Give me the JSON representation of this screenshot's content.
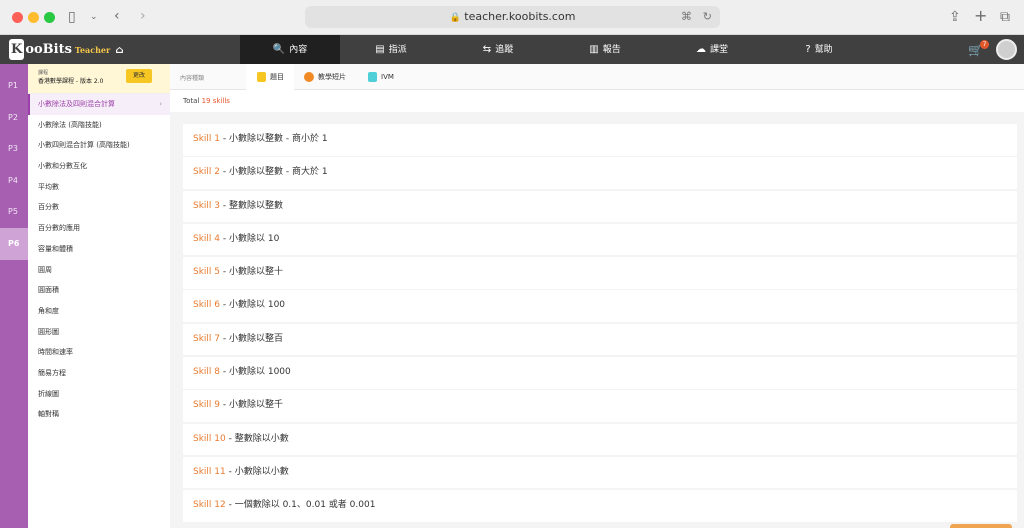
{
  "browser": {
    "url": "teacher.koobits.com"
  },
  "brand": {
    "logo_k": "K",
    "logo_rest": "ooBits",
    "logo_sub": "Teacher"
  },
  "nav": [
    {
      "icon": "search-icon",
      "glyph": "🔍",
      "label": "內容"
    },
    {
      "icon": "assign-icon",
      "glyph": "▤",
      "label": "指派"
    },
    {
      "icon": "track-icon",
      "glyph": "⇆",
      "label": "追蹤"
    },
    {
      "icon": "report-icon",
      "glyph": "▥",
      "label": "報告"
    },
    {
      "icon": "classroom-icon",
      "glyph": "☁",
      "label": "課堂"
    },
    {
      "icon": "help-icon",
      "glyph": "?",
      "label": "幫助"
    }
  ],
  "cart": {
    "count": "7"
  },
  "levels": [
    "P1",
    "P2",
    "P3",
    "P4",
    "P5",
    "P6"
  ],
  "course": {
    "label": "課程",
    "name": "香港數學課程 - 版本 2.0",
    "change": "更改"
  },
  "topics": [
    "小數除法及四則混合計算",
    "小數除法 (高階技能)",
    "小數四則混合計算 (高階技能)",
    "小數和分數互化",
    "平均數",
    "百分數",
    "百分數的應用",
    "容量和體積",
    "圓周",
    "圓面積",
    "角和度",
    "圓形圖",
    "時間和速率",
    "簡易方程",
    "折線圖",
    "軸對稱"
  ],
  "tabs": {
    "label": "內容種類",
    "items": [
      "題目",
      "教學短片",
      "IVM"
    ]
  },
  "total": {
    "prefix": "Total",
    "count": "19 skills"
  },
  "skills": [
    {
      "tag": "Skill 1",
      "name": " - 小數除以整數 - 商小於 1"
    },
    {
      "tag": "Skill 2",
      "name": " - 小數除以整數 - 商大於 1"
    },
    {
      "tag": "Skill 3",
      "name": " - 整數除以整數"
    },
    {
      "tag": "Skill 4",
      "name": " - 小數除以 10"
    },
    {
      "tag": "Skill 5",
      "name": " - 小數除以整十"
    },
    {
      "tag": "Skill 6",
      "name": " - 小數除以 100"
    },
    {
      "tag": "Skill 7",
      "name": " - 小數除以整百"
    },
    {
      "tag": "Skill 8",
      "name": " - 小數除以 1000"
    },
    {
      "tag": "Skill 9",
      "name": " - 小數除以整千"
    },
    {
      "tag": "Skill 10",
      "name": " - 整數除以小數"
    },
    {
      "tag": "Skill 11",
      "name": " - 小數除以小數"
    },
    {
      "tag": "Skill 12",
      "name": " - 一個數除以 0.1、0.01 或者 0.001"
    }
  ]
}
